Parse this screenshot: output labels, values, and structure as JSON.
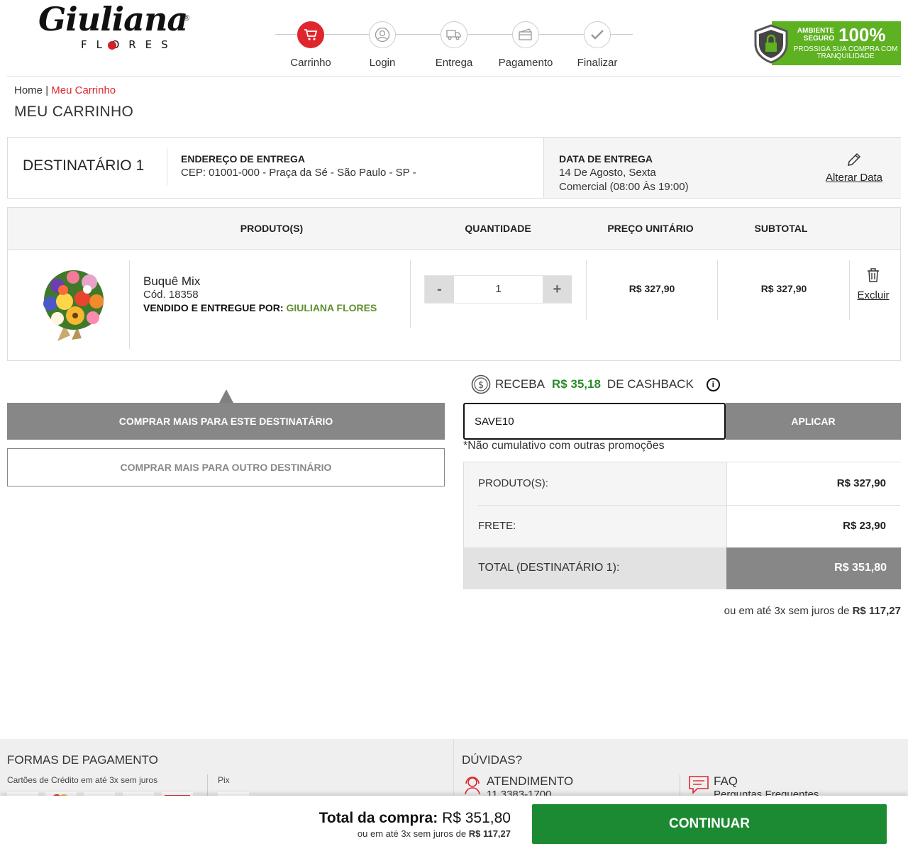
{
  "brand": {
    "logo_script": "Giuliana",
    "logo_sub": "FLORES",
    "reg_mark": "®"
  },
  "steps": [
    {
      "label": "Carrinho",
      "icon": "cart-icon",
      "active": true
    },
    {
      "label": "Login",
      "icon": "user-icon",
      "active": false
    },
    {
      "label": "Entrega",
      "icon": "truck-icon",
      "active": false
    },
    {
      "label": "Pagamento",
      "icon": "credit-card-icon",
      "active": false
    },
    {
      "label": "Finalizar",
      "icon": "check-icon",
      "active": false
    }
  ],
  "secure_badge": {
    "line1": "AMBIENTE SEGURO",
    "percent": "100%",
    "line2": "PROSSIGA SUA COMPRA COM TRANQUILIDADE"
  },
  "breadcrumb": {
    "home": "Home",
    "separator": "|",
    "current": "Meu Carrinho"
  },
  "page_title": "MEU CARRINHO",
  "recipient": {
    "name": "DESTINATÁRIO 1",
    "address_header": "ENDEREÇO DE ENTREGA",
    "address": "CEP: 01001-000 - Praça da Sé - São Paulo - SP -",
    "date_header": "DATA DE ENTREGA",
    "date": "14 De Agosto, Sexta",
    "period": "Comercial (08:00 Às 19:00)",
    "change_date_label": "Alterar Data"
  },
  "table": {
    "headers": {
      "product": "PRODUTO(S)",
      "quantity": "QUANTIDADE",
      "unit_price": "PREÇO UNITÁRIO",
      "subtotal": "SUBTOTAL"
    },
    "rows": [
      {
        "name": "Buquê Mix",
        "code": "Cód. 18358",
        "seller_label": "VENDIDO E ENTREGUE POR:",
        "seller": "GIULIANA FLORES",
        "quantity": "1",
        "minus": "-",
        "plus": "+",
        "unit_price": "R$ 327,90",
        "subtotal": "R$ 327,90",
        "delete_label": "Excluir"
      }
    ]
  },
  "buy_more": {
    "same": "COMPRAR MAIS PARA ESTE DESTINATÁRIO",
    "other": "COMPRAR MAIS PARA OUTRO DESTINÁRIO"
  },
  "cashback": {
    "prefix": "RECEBA",
    "amount": "R$ 35,18",
    "suffix": "DE CASHBACK",
    "info": "i"
  },
  "coupon": {
    "value": "SAVE10",
    "apply_label": "APLICAR",
    "note": "*Não cumulativo com outras promoções"
  },
  "summary": {
    "products_label": "PRODUTO(S):",
    "products_value": "R$ 327,90",
    "shipping_label": "FRETE:",
    "shipping_value": "R$ 23,90",
    "total_label": "TOTAL (DESTINATÁRIO 1):",
    "total_value": "R$ 351,80",
    "installments_text": "ou em até 3x sem juros de",
    "installments_value": "R$ 117,27"
  },
  "footer": {
    "payment_title": "FORMAS DE PAGAMENTO",
    "cards_label": "Cartões de Crédito em até 3x sem juros",
    "pix_label": "Pix",
    "help_title": "DÚVIDAS?",
    "support_title": "ATENDIMENTO",
    "support_phone": "11 3383-1700",
    "faq_title": "FAQ",
    "faq_sub": "Perguntas Frequentes"
  },
  "bottom_bar": {
    "total_label": "Total da compra:",
    "total_value": "R$ 351,80",
    "installments_text": "ou em até 3x sem juros de",
    "installments_value": "R$ 117,27",
    "continue_label": "CONTINUAR"
  },
  "colors": {
    "brand_red": "#e0262d",
    "green": "#1c8a33",
    "secure_green": "#5eb121",
    "gray_button": "#878787"
  }
}
